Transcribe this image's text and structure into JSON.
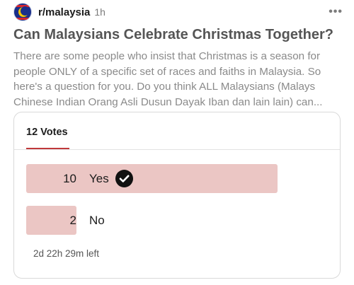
{
  "post": {
    "subreddit": "r/malaysia",
    "time": "1h",
    "more_icon": "•••",
    "title": "Can Malaysians Celebrate Christmas Together?",
    "body_lines": [
      "There are some people who insist that Christmas is a season for",
      "people ONLY of a specific set of races and faiths in Malaysia. So",
      "here's a question for you. Do you think ALL Malaysians (Malays",
      "Chinese Indian Orang Asli Dusun Dayak Iban dan lain lain) can..."
    ]
  },
  "poll": {
    "votes_label": "12 Votes",
    "options": [
      {
        "label": "Yes",
        "count": "10",
        "fraction": 0.8333,
        "selected": true
      },
      {
        "label": "No",
        "count": "2",
        "fraction": 0.1667,
        "selected": false
      }
    ],
    "time_left": "2d 22h 29m left"
  },
  "colors": {
    "bar": "#ebc6c4",
    "accent_underline": "#c0393b",
    "avatar_blue": "#1a2f8a",
    "avatar_yellow": "#f7c600",
    "avatar_red": "#d8262f"
  },
  "icons": {
    "avatar": "malaysia-flag-avatar-icon",
    "more": "more-options-icon",
    "selected": "check-circle-icon"
  }
}
